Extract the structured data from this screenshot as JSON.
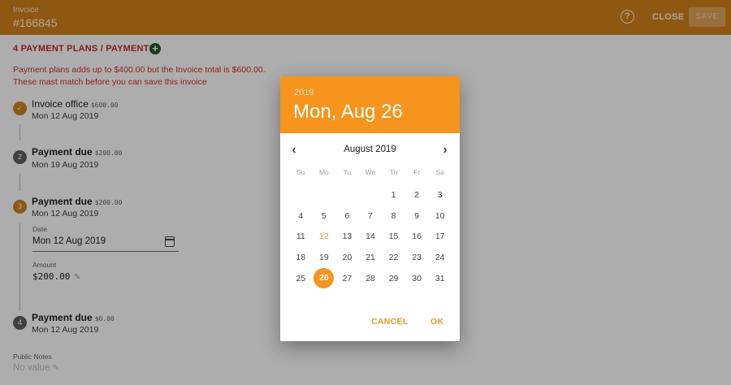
{
  "header": {
    "doc_type": "Invoice",
    "doc_number": "#166845",
    "help_icon": "help-circle-icon",
    "close_label": "CLOSE",
    "save_label": "SAVE",
    "accent": "#d3821b"
  },
  "plans": {
    "title": "4 PAYMENT PLANS / PAYMENTS",
    "add_icon": "plus-circle-icon",
    "warning_line1": "Payment plans adds up to $400.00 but the Invoice total is $600.00.",
    "warning_line2": "These mast match before you can save this invoice",
    "steps": [
      {
        "marker": "✓",
        "title": "Invoice office",
        "amount": "$600.00",
        "date": "Mon 12 Aug 2019"
      },
      {
        "marker": "2",
        "title": "Payment due",
        "amount": "$200.00",
        "date": "Mon 19 Aug 2019"
      },
      {
        "marker": "3",
        "title": "Payment due",
        "amount": "$200.00",
        "date": "Mon 12 Aug 2019"
      },
      {
        "marker": "4",
        "title": "Payment due",
        "amount": "$0.00",
        "date": "Mon 12 Aug 2019"
      }
    ],
    "editor": {
      "date_label": "Date",
      "date_value": "Mon 12 Aug 2019",
      "calendar_icon": "calendar-icon",
      "amount_label": "Amount",
      "amount_value": "$200.00",
      "edit_icon": "pencil-icon"
    }
  },
  "public_notes": {
    "label": "Public Notes",
    "value": "No value"
  },
  "date_picker": {
    "year": "2019",
    "selected_title": "Mon, Aug 26",
    "month_label": "August 2019",
    "prev_icon": "chevron-left-icon",
    "next_icon": "chevron-right-icon",
    "weekdays": [
      "Su",
      "Mo",
      "Tu",
      "We",
      "Th",
      "Fr",
      "Sa"
    ],
    "days": [
      "",
      "",
      "",
      "",
      "1",
      "2",
      "3",
      "4",
      "5",
      "6",
      "7",
      "8",
      "9",
      "10",
      "11",
      "12",
      "13",
      "14",
      "15",
      "16",
      "17",
      "18",
      "19",
      "20",
      "21",
      "22",
      "23",
      "24",
      "25",
      "26",
      "27",
      "28",
      "29",
      "30",
      "31"
    ],
    "today": "12",
    "selected": "26",
    "cancel_label": "CANCEL",
    "ok_label": "OK",
    "accent": "#f7941d"
  }
}
